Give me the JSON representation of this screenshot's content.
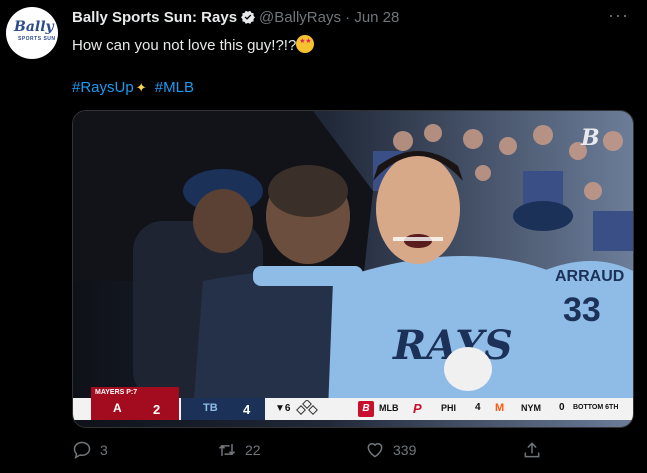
{
  "tweet": {
    "author_name": "Bally Sports Sun: Rays",
    "handle": "@BallyRays",
    "separator": "·",
    "date": "Jun 28",
    "text": "How can you not love this guy!?!?",
    "hashtag_1": "#RaysUp",
    "hashtag_2": "#MLB",
    "more_icon": "more-dots-icon"
  },
  "avatar": {
    "brand_word": "Bally",
    "brand_sub": "SPORTS SUN"
  },
  "scorebug": {
    "batter_label": "MAYERS P:7",
    "away_team": "LAA",
    "away_score": "2",
    "home_team": "TB",
    "home_score": "4",
    "inning": "▼6",
    "network": "MLB",
    "other_game": {
      "team_1": "PHI",
      "score_1": "4",
      "team_2": "NYM",
      "score_2": "0",
      "status": "BOTTOM 6TH"
    }
  },
  "jersey": {
    "team_text": "RAYS",
    "back_name": "ARRAUD",
    "back_number": "33"
  },
  "metrics": {
    "replies": "3",
    "retweets": "22",
    "likes": "339"
  },
  "colors": {
    "link": "#1d9bf0",
    "muted": "#71767b",
    "angels_red": "#a30c1e",
    "rays_navy": "#1b3158",
    "rays_powder": "#8fbce6"
  }
}
